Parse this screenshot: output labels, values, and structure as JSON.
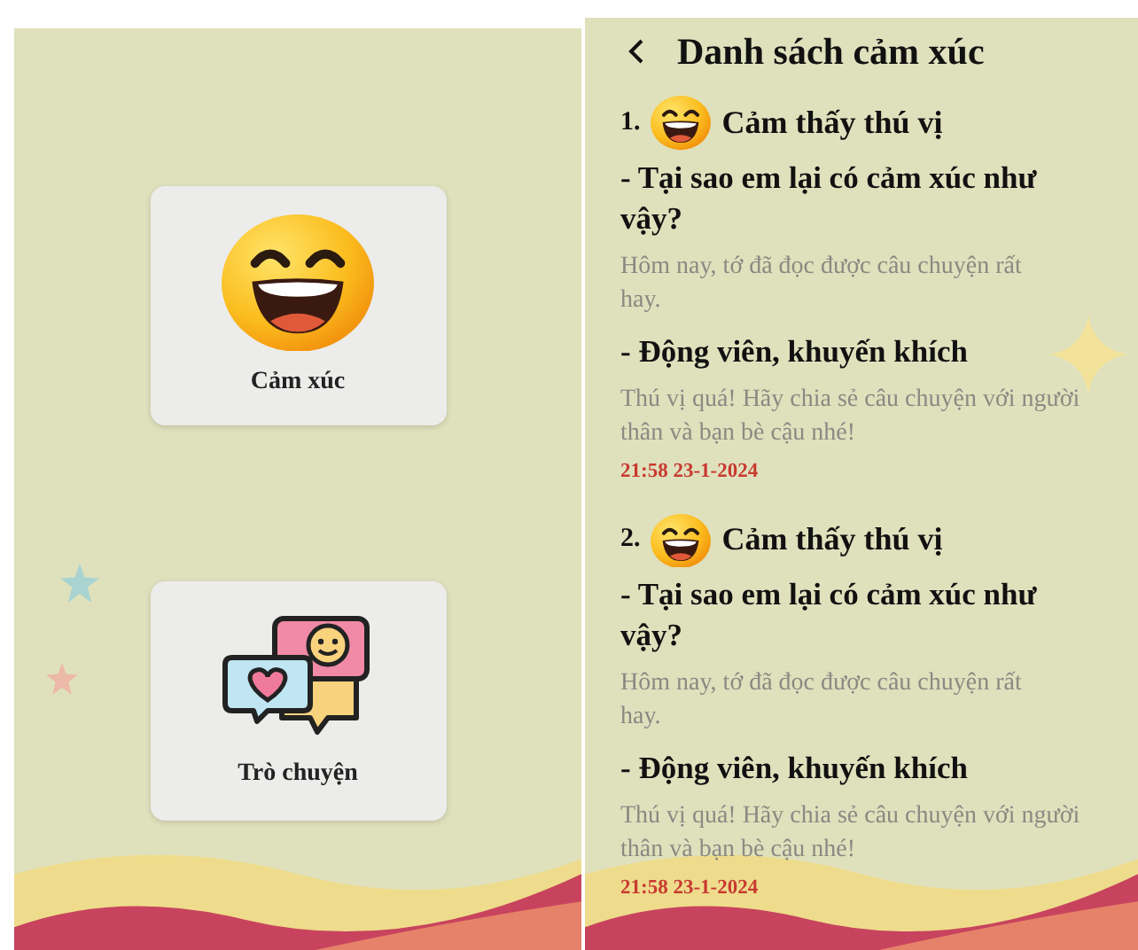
{
  "home": {
    "cards": [
      {
        "kind": "emotion",
        "label": "Cảm xúc"
      },
      {
        "kind": "chat",
        "label": "Trò chuyện"
      }
    ]
  },
  "list": {
    "title": "Danh sách cảm xúc",
    "entries": [
      {
        "number": "1.",
        "emotion": "Cảm thấy thú vị",
        "question": "- Tại sao em lại có cảm xúc như vậy?",
        "answer": "Hôm nay, tớ đã đọc được câu chuyện rất hay.",
        "advice_title": "- Động viên, khuyến khích",
        "advice": "Thú vị quá! Hãy chia sẻ câu chuyện với người thân và bạn bè cậu nhé!",
        "timestamp": "21:58 23-1-2024"
      },
      {
        "number": "2.",
        "emotion": "Cảm thấy thú vị",
        "question": "- Tại sao em lại có cảm xúc như vậy?",
        "answer": "Hôm nay, tớ đã đọc được câu chuyện rất hay.",
        "advice_title": "- Động viên, khuyến khích",
        "advice": "Thú vị quá! Hãy chia sẻ câu chuyện với người thân và bạn bè cậu nhé!",
        "timestamp": "21:58 23-1-2024"
      }
    ]
  }
}
